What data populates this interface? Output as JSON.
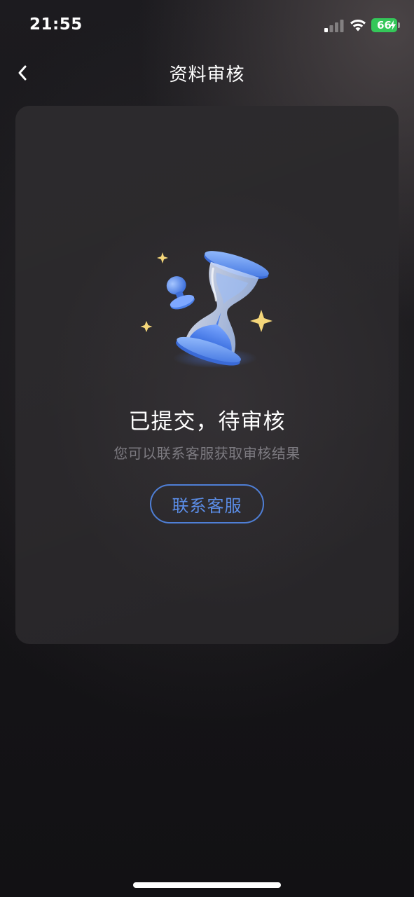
{
  "status_bar": {
    "time": "21:55",
    "battery_level": "66",
    "icons": [
      "cellular-signal-icon",
      "wifi-icon",
      "battery-charging-icon"
    ]
  },
  "nav": {
    "title": "资料审核",
    "back_icon": "chevron-left-icon"
  },
  "review": {
    "illustration_icon": "hourglass-stamp-icon",
    "title": "已提交，待审核",
    "subtitle": "您可以联系客服获取审核结果",
    "contact_button_label": "联系客服"
  },
  "colors": {
    "accent": "#5b8de6",
    "battery": "#34c759",
    "sparkle": "#f5d77a"
  }
}
